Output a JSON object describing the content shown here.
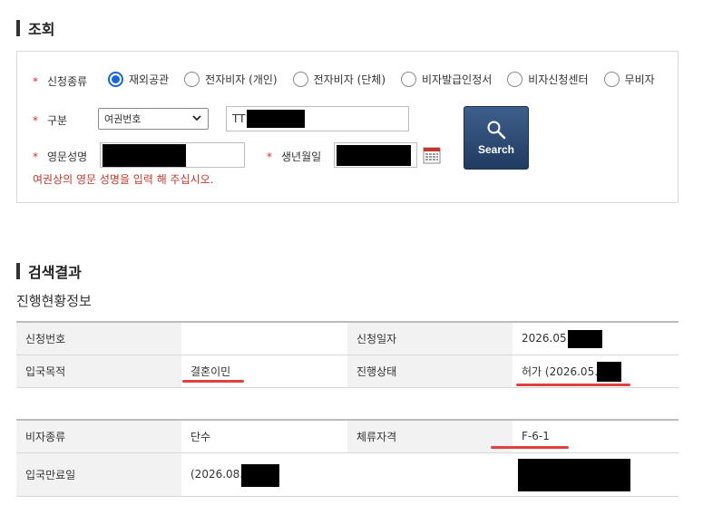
{
  "inquiry": {
    "title": "조회",
    "apply_type_label": "신청종류",
    "apply_types": [
      "재외공관",
      "전자비자 (개인)",
      "전자비자 (단체)",
      "비자발급인정서",
      "비자신청센터",
      "무비자"
    ],
    "selected_index": 0,
    "division_label": "구분",
    "division_selected": "여권번호",
    "passport_prefix": "TT",
    "eng_name_label": "영문성명",
    "birth_label": "생년월일",
    "hint": "여권상의 영문 성명을 입력 해 주십시오.",
    "search_button": "Search",
    "required_mark": "*"
  },
  "results": {
    "title": "검색결과",
    "subtitle": "진행현황정보",
    "table1": {
      "app_no_label": "신청번호",
      "app_no_value": "",
      "app_date_label": "신청일자",
      "app_date_value": "2026.05.",
      "purpose_label": "입국목적",
      "purpose_value": "결혼이민",
      "status_label": "진행상태",
      "status_value": "허가 (2026.05."
    },
    "table2": {
      "visa_type_label": "비자종류",
      "visa_type_value": "단수",
      "stay_label": "체류자격",
      "stay_value": "F-6-1",
      "expiry_label": "입국만료일",
      "expiry_value": "(2026.08."
    }
  },
  "colors": {
    "accent": "#1a66d2",
    "button": "#2c4a74",
    "required": "#d0312d",
    "underline": "#e04040"
  }
}
